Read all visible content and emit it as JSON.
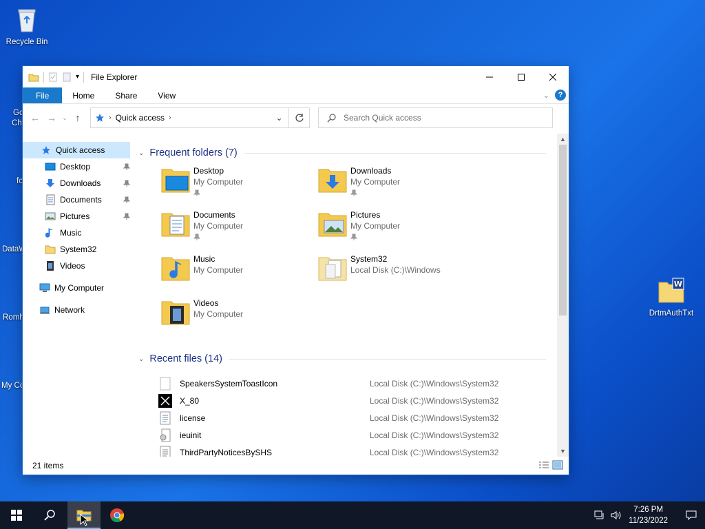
{
  "desktop": {
    "icons": [
      {
        "label": "Recycle Bin"
      },
      {
        "label": "DrtmAuthTxt"
      }
    ],
    "partial_labels": [
      "Go",
      "Ch",
      "fo",
      "DataW",
      "Romh",
      "My Co"
    ]
  },
  "window": {
    "title": "File Explorer",
    "tabs": [
      "File",
      "Home",
      "Share",
      "View"
    ],
    "help": "?",
    "address": {
      "crumb": "Quick access"
    },
    "search": {
      "placeholder": "Search Quick access"
    },
    "status": "21 items"
  },
  "sidebar": {
    "items": [
      {
        "label": "Quick access",
        "icon": "star-icon",
        "selected": true,
        "pinned": false
      },
      {
        "label": "Desktop",
        "icon": "desktop-icon",
        "pinned": true
      },
      {
        "label": "Downloads",
        "icon": "download-icon",
        "pinned": true
      },
      {
        "label": "Documents",
        "icon": "documents-icon",
        "pinned": true
      },
      {
        "label": "Pictures",
        "icon": "pictures-icon",
        "pinned": true
      },
      {
        "label": "Music",
        "icon": "music-icon",
        "pinned": false
      },
      {
        "label": "System32",
        "icon": "folder-icon",
        "pinned": false
      },
      {
        "label": "Videos",
        "icon": "videos-icon",
        "pinned": false
      },
      {
        "label": "My Computer",
        "icon": "computer-icon",
        "pinned": false
      },
      {
        "label": "Network",
        "icon": "network-icon",
        "pinned": false
      }
    ]
  },
  "frequent": {
    "header": "Frequent folders (7)",
    "items": [
      {
        "name": "Desktop",
        "sub": "My Computer",
        "pinned": true,
        "icon": "desktop-folder-icon"
      },
      {
        "name": "Downloads",
        "sub": "My Computer",
        "pinned": true,
        "icon": "downloads-folder-icon"
      },
      {
        "name": "Documents",
        "sub": "My Computer",
        "pinned": true,
        "icon": "documents-folder-icon"
      },
      {
        "name": "Pictures",
        "sub": "My Computer",
        "pinned": true,
        "icon": "pictures-folder-icon"
      },
      {
        "name": "Music",
        "sub": "My Computer",
        "pinned": false,
        "icon": "music-folder-icon"
      },
      {
        "name": "System32",
        "sub": "Local Disk (C:)\\Windows",
        "pinned": false,
        "icon": "system32-folder-icon"
      },
      {
        "name": "Videos",
        "sub": "My Computer",
        "pinned": false,
        "icon": "videos-folder-icon"
      }
    ]
  },
  "recent": {
    "header": "Recent files (14)",
    "items": [
      {
        "name": "SpeakersSystemToastIcon",
        "location": "Local Disk (C:)\\Windows\\System32"
      },
      {
        "name": "X_80",
        "location": "Local Disk (C:)\\Windows\\System32"
      },
      {
        "name": "license",
        "location": "Local Disk (C:)\\Windows\\System32"
      },
      {
        "name": "ieuinit",
        "location": "Local Disk (C:)\\Windows\\System32"
      },
      {
        "name": "ThirdPartyNoticesBySHS",
        "location": "Local Disk (C:)\\Windows\\System32"
      }
    ]
  },
  "taskbar": {
    "time": "7:26 PM",
    "date": "11/23/2022"
  },
  "colors": {
    "accent": "#1979ca",
    "selection": "#cce8ff",
    "group_header": "#1e3287",
    "taskbar": "#101828"
  }
}
